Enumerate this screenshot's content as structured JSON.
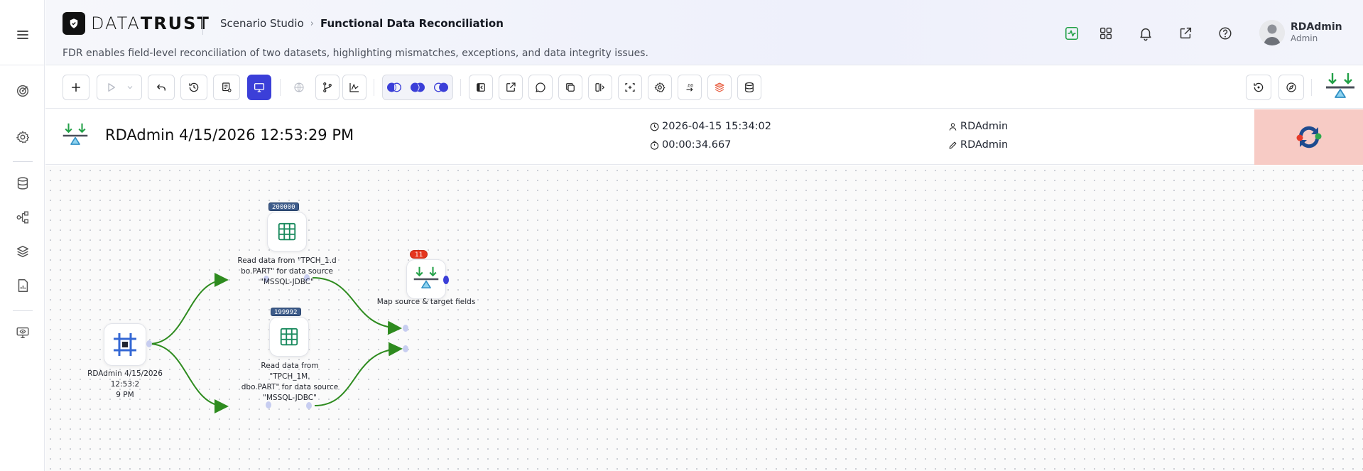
{
  "header": {
    "logo_light": "DATA",
    "logo_bold": "TRUST",
    "breadcrumb_1": "Scenario Studio",
    "breadcrumb_2": "Functional Data Reconciliation",
    "subtitle": "FDR enables field-level reconciliation of two datasets, highlighting mismatches, exceptions, and data integrity issues.",
    "icons": [
      "activity-icon",
      "apps-grid-icon",
      "bell-icon",
      "external-link-icon",
      "help-icon"
    ],
    "user_name": "RDAdmin",
    "user_role": "Admin"
  },
  "rail": {
    "items": [
      "target-icon",
      "settings-icon",
      "database-icon",
      "flow-icon",
      "layers-icon",
      "report-icon",
      "monitor-eye-icon"
    ]
  },
  "toolbar": {
    "buttons": [
      "add",
      "run",
      "undo",
      "history",
      "cpu-settings",
      "monitor",
      "globe",
      "branch",
      "chart",
      "join-left",
      "join-inner",
      "join-right",
      "collapse-panel",
      "export",
      "comment",
      "copy",
      "split",
      "scan",
      "gear",
      "transform",
      "stack",
      "database",
      "restore",
      "compass",
      "reconcile-logo"
    ]
  },
  "info": {
    "title": "RDAdmin 4/15/2026 12:53:29 PM",
    "datetime": "2026-04-15 15:34:02",
    "duration": "00:00:34.667",
    "owner": "RDAdmin",
    "editor": "RDAdmin"
  },
  "colors": {
    "accent": "#3b3fd8",
    "edge": "#2e8b1f",
    "badge": "#3e5c8a",
    "error_badge": "#e5361f",
    "status_bg": "#f7cbc5"
  },
  "flow": {
    "start_label": "RDAdmin 4/15/2026 12:53:2\n9 PM",
    "read1_count": "200000",
    "read1_label": "Read data from \"TPCH_1.d\nbo.PART\" for data source\n\"MSSQL-JDBC\"",
    "read2_count": "199992",
    "read2_label": "Read data from \"TPCH_1M.\ndbo.PART\" for data source\n\"MSSQL-JDBC\"",
    "map_count": "11",
    "map_label": "Map source & target fields"
  }
}
